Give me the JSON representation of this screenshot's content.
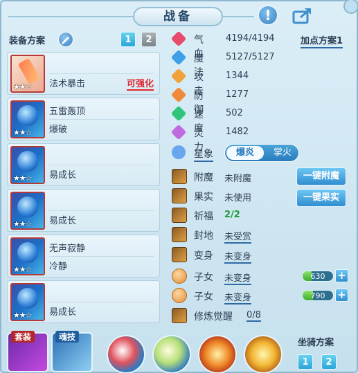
{
  "window": {
    "title": "战备"
  },
  "left": {
    "scheme_label": "装备方案",
    "scheme_tabs": [
      "1",
      "2"
    ],
    "slots": [
      {
        "line1": "法术暴击",
        "line2": "",
        "action": "可强化",
        "stars": "★★☆"
      },
      {
        "line1": "五雷轰顶",
        "line2": "爆破",
        "action": "",
        "stars": "★★☆"
      },
      {
        "line1": "",
        "line2": "易成长",
        "action": "",
        "stars": "★★☆"
      },
      {
        "line1": "",
        "line2": "易成长",
        "action": "",
        "stars": "★★☆"
      },
      {
        "line1": "无声寂静",
        "line2": "冷静",
        "action": "",
        "stars": "★★☆"
      },
      {
        "line1": "",
        "line2": "易成长",
        "action": "",
        "stars": "★★☆"
      }
    ]
  },
  "stats": {
    "plan_button": "加点方案1",
    "items": [
      {
        "label": "气血",
        "value": "4194/4194",
        "color": "#e84a6a"
      },
      {
        "label": "魔法",
        "value": "5127/5127",
        "color": "#3da0e8"
      },
      {
        "label": "攻击",
        "value": "1344",
        "color": "#f2a23a"
      },
      {
        "label": "防御",
        "value": "1277",
        "color": "#f08a3a"
      },
      {
        "label": "速度",
        "value": "502",
        "color": "#2ec47a"
      },
      {
        "label": "灵力",
        "value": "1482",
        "color": "#c06ae0"
      }
    ],
    "star_sign": {
      "label": "星象",
      "options": [
        "爆炎",
        "掌火"
      ],
      "selected": "爆炎"
    }
  },
  "extras": [
    {
      "label": "附魔",
      "value": "未附魔"
    },
    {
      "label": "果实",
      "value": "未使用"
    },
    {
      "label": "祈福",
      "value": "2/2"
    },
    {
      "label": "封地",
      "value": "未受赏"
    },
    {
      "label": "变身",
      "value": "未变身"
    },
    {
      "label": "子女",
      "value": "未变身",
      "bar": "630",
      "bar_level": 0.3
    },
    {
      "label": "子女",
      "value": "未变身",
      "bar": "790",
      "bar_level": 0.35
    },
    {
      "label": "修炼觉醒",
      "value": "0/8"
    }
  ],
  "buttons": {
    "enchant": "一键附魔",
    "fruit": "一键果实"
  },
  "bottom": {
    "set_tag": "套装",
    "skill_tag": "魂技",
    "mount_label": "坐骑方案",
    "mount_tabs": [
      "1",
      "2"
    ]
  }
}
